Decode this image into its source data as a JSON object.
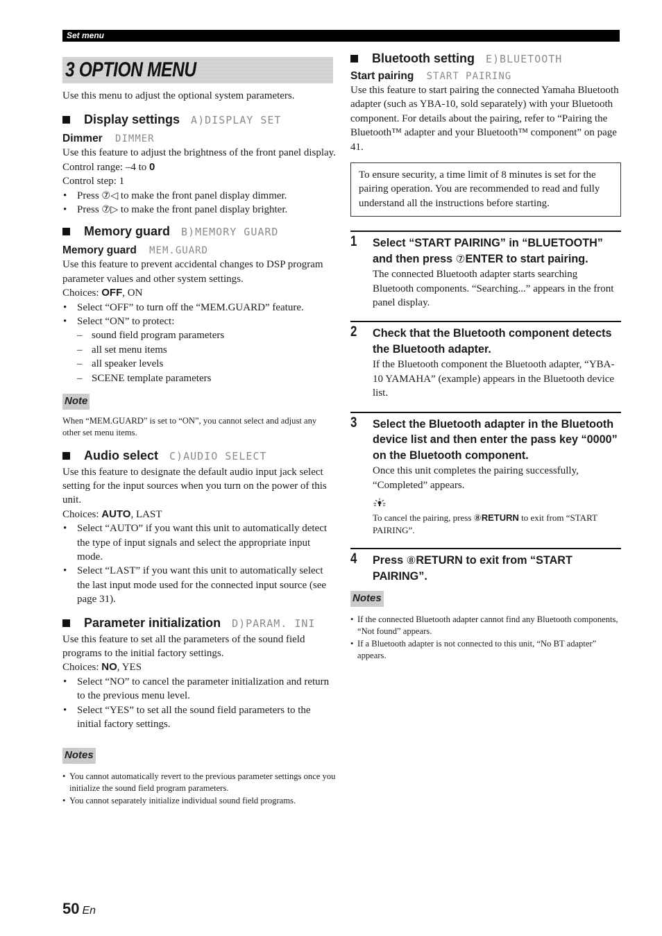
{
  "header": {
    "section_label": "Set menu"
  },
  "banner": {
    "title": "3 OPTION MENU"
  },
  "intro": "Use this menu to adjust the optional system parameters.",
  "display_settings": {
    "heading": "Display settings",
    "lcd": "A)DISPLAY SET",
    "dimmer": {
      "title": "Dimmer",
      "lcd": "DIMMER",
      "desc": "Use this feature to adjust the brightness of the front panel display.",
      "range_label": "Control range: –4 to ",
      "range_default": "0",
      "step": "Control step: 1",
      "bullets": [
        {
          "pre": "Press ",
          "key": "⑦◁",
          "post": " to make the front panel display dimmer."
        },
        {
          "pre": "Press ",
          "key": "⑦▷",
          "post": " to make the front panel display brighter."
        }
      ]
    }
  },
  "memory_guard": {
    "heading": "Memory guard",
    "lcd": "B)MEMORY GUARD",
    "sub": {
      "title": "Memory guard",
      "lcd": "MEM.GUARD",
      "desc": "Use this feature to prevent accidental changes to DSP program parameter values and other system settings.",
      "choices_label": "Choices: ",
      "choices_default": "OFF",
      "choices_rest": ", ON",
      "bullets": [
        "Select “OFF” to turn off the “MEM.GUARD” feature.",
        "Select “ON” to protect:"
      ],
      "protect_items": [
        "sound field program parameters",
        "all set menu items",
        "all speaker levels",
        "SCENE template parameters"
      ]
    },
    "note_label": "Note",
    "note": "When “MEM.GUARD” is set to “ON”, you cannot select and adjust any other set menu items."
  },
  "audio_select": {
    "heading": "Audio select",
    "lcd": "C)AUDIO SELECT",
    "desc": "Use this feature to designate the default audio input jack select setting for the input sources when you turn on the power of this unit.",
    "choices_label": "Choices: ",
    "choices_default": "AUTO",
    "choices_rest": ", LAST",
    "bullets": [
      "Select “AUTO” if you want this unit to automatically detect the type of input signals and select the appropriate input mode.",
      "Select “LAST” if you want this unit to automatically select the last input mode used for the connected input source (see page 31)."
    ]
  },
  "param_init": {
    "heading": "Parameter initialization",
    "lcd": "D)PARAM. INI",
    "desc": "Use this feature to set all the parameters of the sound field programs to the initial factory settings.",
    "choices_label": "Choices: ",
    "choices_default": "NO",
    "choices_rest": ", YES",
    "bullets": [
      "Select “NO” to cancel the parameter initialization and return to the previous menu level.",
      "Select “YES” to set all the sound field parameters to the initial factory settings."
    ],
    "notes_label": "Notes",
    "notes": [
      "You cannot automatically revert to the previous parameter settings once you initialize the sound field program parameters.",
      "You cannot separately initialize individual sound field programs."
    ]
  },
  "bluetooth": {
    "heading": "Bluetooth setting",
    "lcd": "E)BLUETOOTH",
    "start_pairing": {
      "title": "Start pairing",
      "lcd": "START PAIRING",
      "desc": "Use this feature to start pairing the connected Yamaha Bluetooth adapter (such as YBA-10, sold separately) with your Bluetooth component. For details about the pairing, refer to “Pairing the Bluetooth™ adapter and your Bluetooth™ component” on page 41."
    },
    "warning": "To ensure security, a time limit of 8 minutes is set for the pairing operation. You are recommended to read and fully understand all the instructions before starting.",
    "steps": [
      {
        "num": "1",
        "title_pre": "Select “START PAIRING” in “BLUETOOTH” and then press ",
        "title_key": "⑦",
        "title_bold": "ENTER",
        "title_post": " to start pairing.",
        "body": "The connected Bluetooth adapter starts searching Bluetooth components. “Searching...” appears in the front panel display."
      },
      {
        "num": "2",
        "title": "Check that the Bluetooth component detects the Bluetooth adapter.",
        "body": "If the Bluetooth component the Bluetooth adapter, “YBA-10 YAMAHA” (example) appears in the Bluetooth device list."
      },
      {
        "num": "3",
        "title": "Select the Bluetooth adapter in the Bluetooth device list and then enter the pass key “0000” on the Bluetooth component.",
        "body": "Once this unit completes the pairing successfully, “Completed” appears.",
        "tip_icon": "lightbulb-icon",
        "tip_pre": "To cancel the pairing, press ",
        "tip_key": "⑧",
        "tip_bold": "RETURN",
        "tip_post": " to exit from “START PAIRING”."
      },
      {
        "num": "4",
        "title_pre": "Press ",
        "title_key": "⑧",
        "title_bold": "RETURN",
        "title_post": " to exit from “START PAIRING”."
      }
    ],
    "notes_label": "Notes",
    "notes": [
      "If the connected Bluetooth adapter cannot find any Bluetooth components, “Not found” appears.",
      "If a Bluetooth adapter is not connected to this unit, “No BT adapter” appears."
    ]
  },
  "footer": {
    "page_number": "50",
    "lang": "En"
  }
}
